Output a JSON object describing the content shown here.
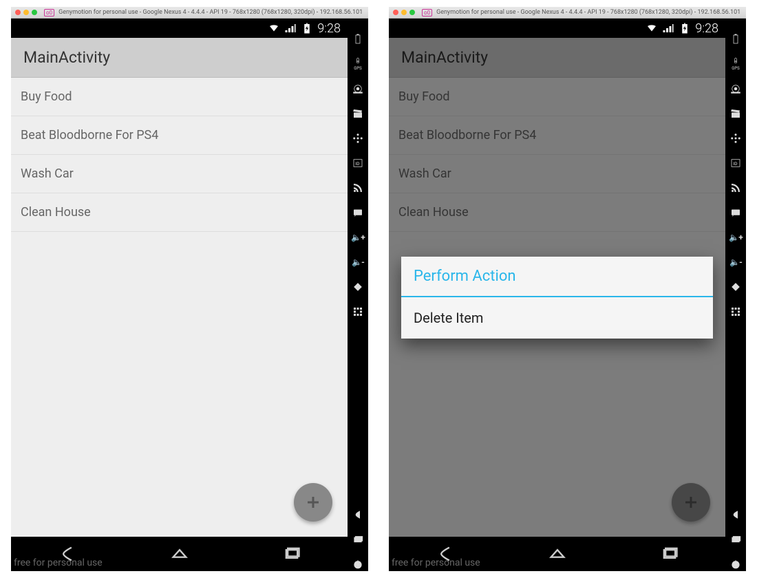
{
  "window": {
    "title": "Genymotion for personal use - Google Nexus 4 - 4.4.4 - API 19 - 768x1280 (768x1280, 320dpi) - 192.168.56.101",
    "watermark": "free for personal use"
  },
  "statusbar": {
    "time": "9:28"
  },
  "app": {
    "title": "MainActivity",
    "items": [
      {
        "label": "Buy Food"
      },
      {
        "label": "Beat Bloodborne For PS4"
      },
      {
        "label": "Wash Car"
      },
      {
        "label": "Clean House"
      }
    ]
  },
  "dialog": {
    "title": "Perform Action",
    "items": [
      {
        "label": "Delete Item"
      }
    ]
  },
  "sidebar_icons": [
    "battery",
    "gps",
    "camera",
    "clapper",
    "move",
    "id-badge",
    "rss",
    "sms",
    "volume-up",
    "volume-down",
    "rotate",
    "pixel-grid",
    "back",
    "multitask",
    "power"
  ],
  "colors": {
    "accent": "#29b6ea",
    "actionbar": "#cecece",
    "bg": "#eeeeee",
    "fab": "#888888"
  }
}
